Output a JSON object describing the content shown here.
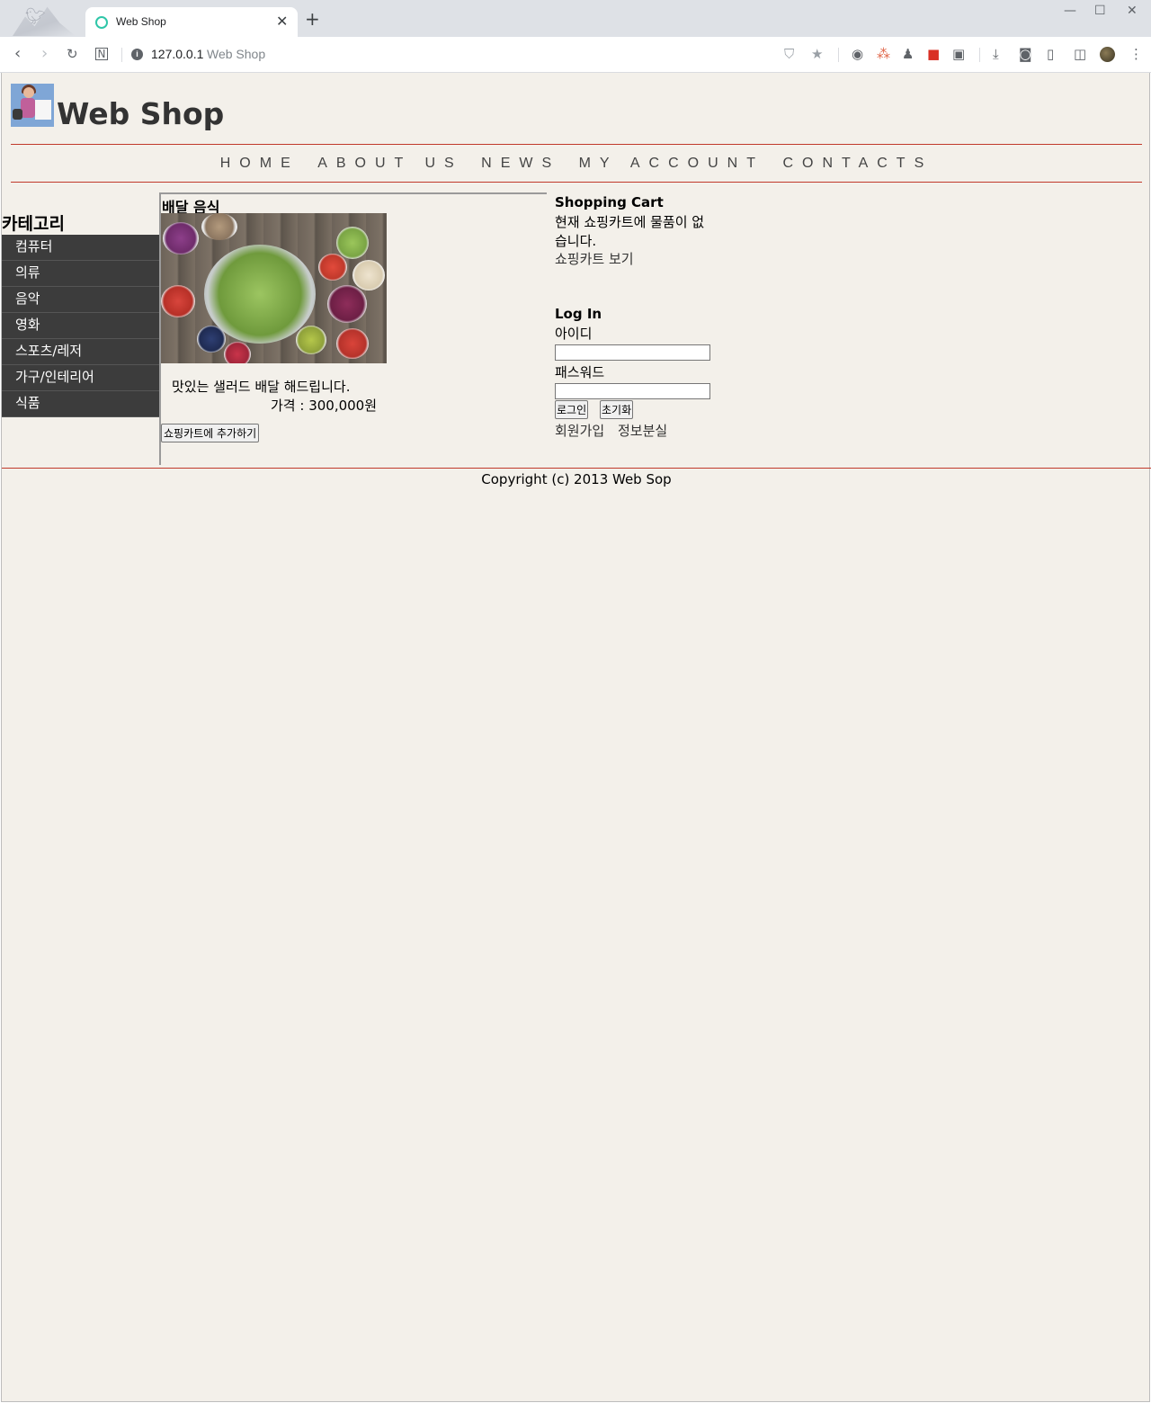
{
  "browser": {
    "tab_title": "Web Shop",
    "url_host": "127.0.0.1",
    "url_title": "Web Shop"
  },
  "site": {
    "title": "Web Shop"
  },
  "nav": [
    "HOME",
    "ABOUT US",
    "NEWS",
    "MY ACCOUNT",
    "CONTACTS"
  ],
  "sidebar": {
    "title": "카테고리",
    "items": [
      "컴퓨터",
      "의류",
      "음악",
      "영화",
      "스포츠/레저",
      "가구/인테리어",
      "식품"
    ]
  },
  "product": {
    "section_title": "배달 음식",
    "description": "맛있는 샐러드 배달 해드립니다.",
    "price": "가격 : 300,000원",
    "add_button": "쇼핑카트에 추가하기"
  },
  "cart": {
    "title": "Shopping Cart",
    "empty_line1": "현재 쇼핑카트에 물품이 없",
    "empty_line2": "습니다.",
    "view_link": "쇼핑카트 보기"
  },
  "login": {
    "title": "Log In",
    "id_label": "아이디",
    "password_label": "패스워드",
    "login_button": "로그인",
    "reset_button": "초기화",
    "signup_link": "회원가입",
    "lost_info_link": "정보분실"
  },
  "footer": {
    "copyright": "Copyright (c) 2013 Web Sop"
  },
  "colors": {
    "page_bg": "#f3f0ea",
    "accent_line": "#c0392b",
    "sidebar_bg": "#3c3c3c"
  }
}
